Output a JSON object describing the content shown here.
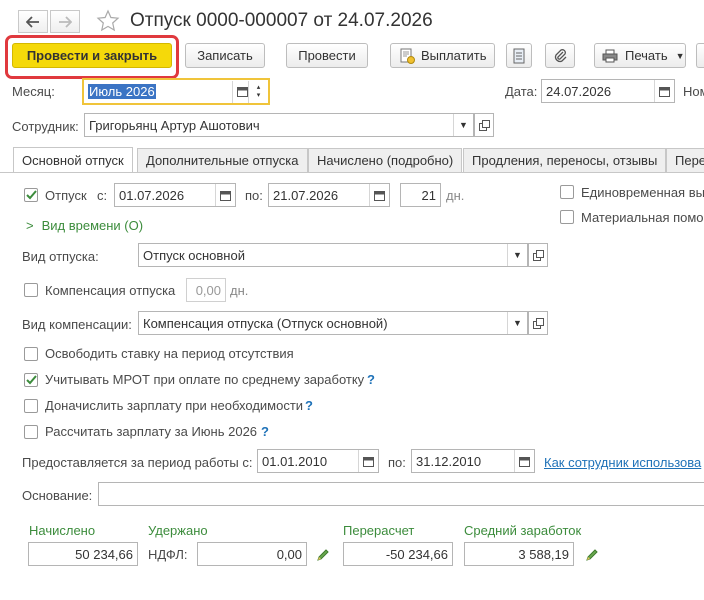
{
  "window": {
    "title": "Отпуск 0000-000007 от 24.07.2026"
  },
  "toolbar": {
    "post_close_label": "Провести и закрыть",
    "save_label": "Записать",
    "post_label": "Провести",
    "pay_label": "Выплатить",
    "print_label": "Печать"
  },
  "header": {
    "month_label": "Месяц:",
    "month_value": "Июль 2026",
    "date_label": "Дата:",
    "date_value": "24.07.2026",
    "number_label_partial": "Ном",
    "employee_label": "Сотрудник:",
    "employee_value": "Григорьянц Артур Ашотович"
  },
  "tabs": [
    {
      "label": "Основной отпуск",
      "active": true
    },
    {
      "label": "Дополнительные отпуска",
      "active": false
    },
    {
      "label": "Начислено (подробно)",
      "active": false
    },
    {
      "label": "Продления, переносы, отзывы",
      "active": false
    },
    {
      "label": "Пере",
      "active": false
    }
  ],
  "main": {
    "vacation_checkbox_label": "Отпуск",
    "vacation_checked": true,
    "from_label": "с:",
    "from_value": "01.07.2026",
    "to_label": "по:",
    "to_value": "21.07.2026",
    "days_value": "21",
    "days_unit": "дн.",
    "one_time_label": "Единовременная вы",
    "material_label": "Материальная помо",
    "time_type_label": "Вид времени (О)",
    "vacation_type_label": "Вид отпуска:",
    "vacation_type_value": "Отпуск основной",
    "compensation_label": "Компенсация отпуска",
    "compensation_value": "0,00",
    "compensation_unit": "дн.",
    "compensation_type_label": "Вид компенсации:",
    "compensation_type_value": "Компенсация отпуска (Отпуск основной)",
    "release_rate_label": "Освободить ставку на период отсутствия",
    "mrot_label": "Учитывать МРОТ при оплате по среднему заработку",
    "mrot_checked": true,
    "extra_pay_label": "Доначислить зарплату при необходимости",
    "calc_salary_label": "Рассчитать зарплату за Июнь 2026",
    "help_mark": "?",
    "period_label": "Предоставляется за период работы с:",
    "period_from": "01.01.2010",
    "period_to_label": "по:",
    "period_to": "31.12.2010",
    "employee_link": "Как сотрудник использова",
    "basis_label": "Основание:",
    "basis_value": ""
  },
  "totals": {
    "accrued_label": "Начислено",
    "accrued_value": "50 234,66",
    "withheld_label": "Удержано",
    "ndfl_label": "НДФЛ:",
    "ndfl_value": "0,00",
    "recalc_label": "Перерасчет",
    "recalc_value": "-50 234,66",
    "avg_label": "Средний заработок",
    "avg_value": "3 588,19"
  },
  "colors": {
    "primary_button": "#f5d90a",
    "highlight_outline": "#e0393e",
    "green_label": "#3c8c3c",
    "link": "#1f72b8"
  }
}
